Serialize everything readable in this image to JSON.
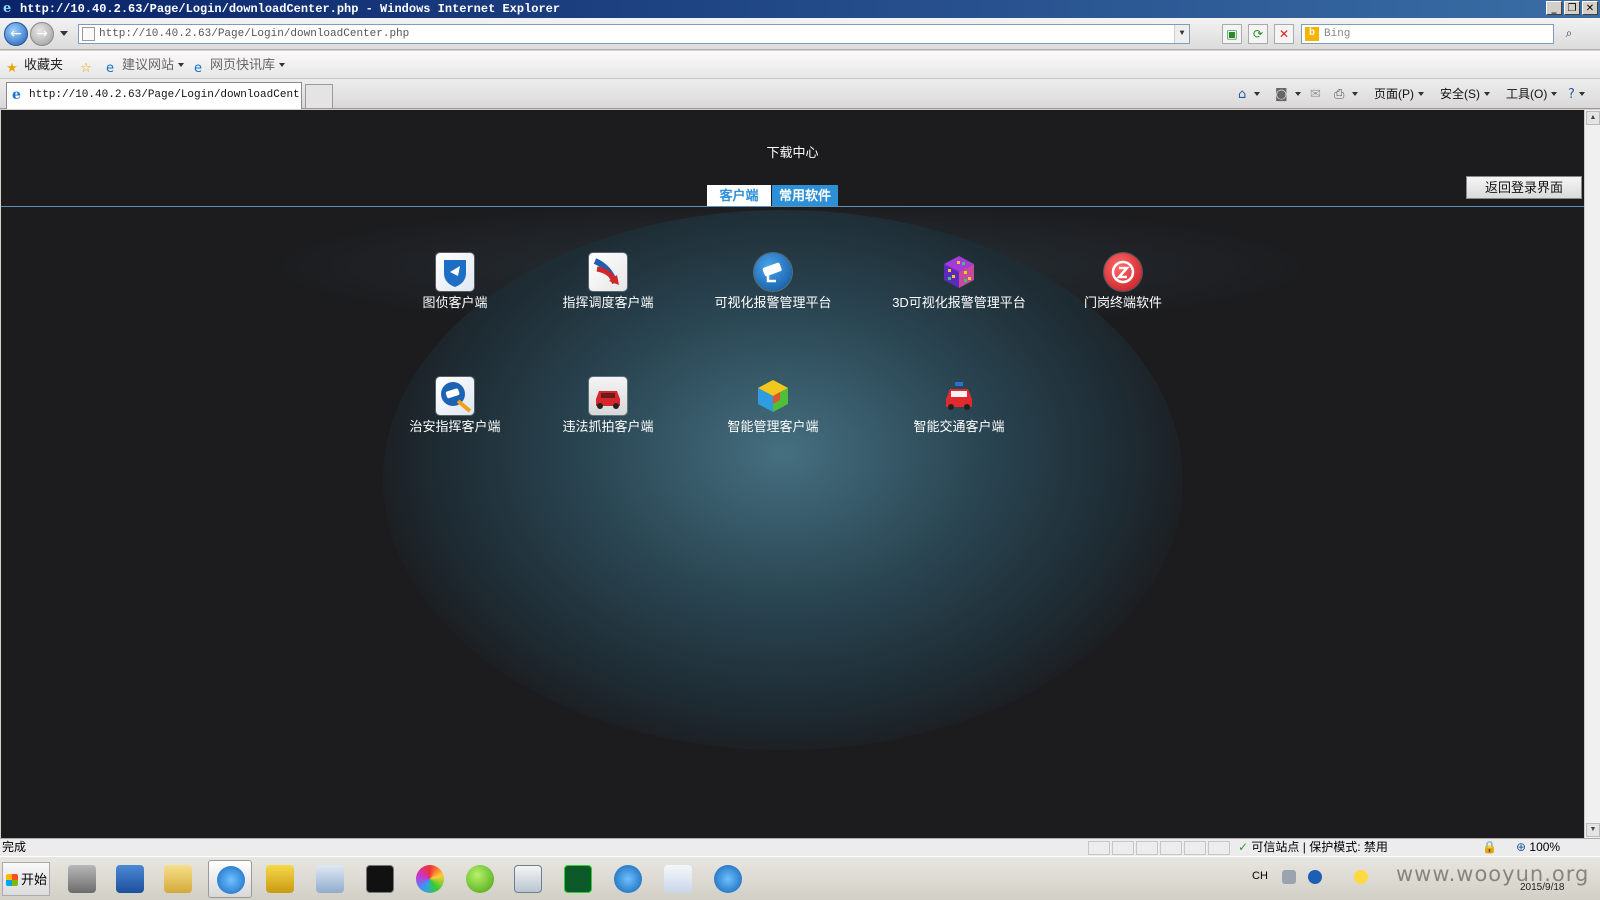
{
  "window": {
    "title": "http://10.40.2.63/Page/Login/downloadCenter.php - Windows Internet Explorer",
    "controls": [
      "_",
      "❐",
      "✕"
    ]
  },
  "toolbar": {
    "url": "http://10.40.2.63/Page/Login/downloadCenter.php",
    "search_placeholder": "Bing",
    "back_glyph": "←",
    "forward_glyph": "→"
  },
  "favorites": {
    "label": "收藏夹",
    "items": [
      "建议网站",
      "网页快讯库"
    ]
  },
  "tabs": {
    "active_title": "http://10.40.2.63/Page/Login/downloadCent..."
  },
  "command_bar": {
    "page": "页面(P)",
    "safety": "安全(S)",
    "tools": "工具(O)"
  },
  "page": {
    "title": "下载中心",
    "tabs": [
      "客户端",
      "常用软件"
    ],
    "back_button": "返回登录界面",
    "apps": [
      {
        "label": "图侦客户端",
        "icon": "shield-icon"
      },
      {
        "label": "指挥调度客户端",
        "icon": "dispatch-arrow-icon"
      },
      {
        "label": "可视化报警管理平台",
        "icon": "camera-icon"
      },
      {
        "label": "3D可视化报警管理平台",
        "icon": "3d-cube-icon"
      },
      {
        "label": "门岗终端软件",
        "icon": "gate-terminal-icon"
      },
      {
        "label": "治安指挥客户端",
        "icon": "security-camera-icon"
      },
      {
        "label": "违法抓拍客户端",
        "icon": "red-car-icon"
      },
      {
        "label": "智能管理客户端",
        "icon": "colorful-cube-icon"
      },
      {
        "label": "智能交通客户端",
        "icon": "police-car-icon"
      }
    ]
  },
  "status": {
    "text": "完成",
    "zone": "可信站点 | 保护模式: 禁用",
    "zoom": "100%"
  },
  "taskbar": {
    "start": "开始",
    "lang": "CH",
    "date": "2015/9/18",
    "watermark": "www.wooyun.org"
  },
  "colors": {
    "page_bg": "#1c1c1e",
    "accent": "#2d8fd6",
    "divider": "#5e90b8"
  }
}
